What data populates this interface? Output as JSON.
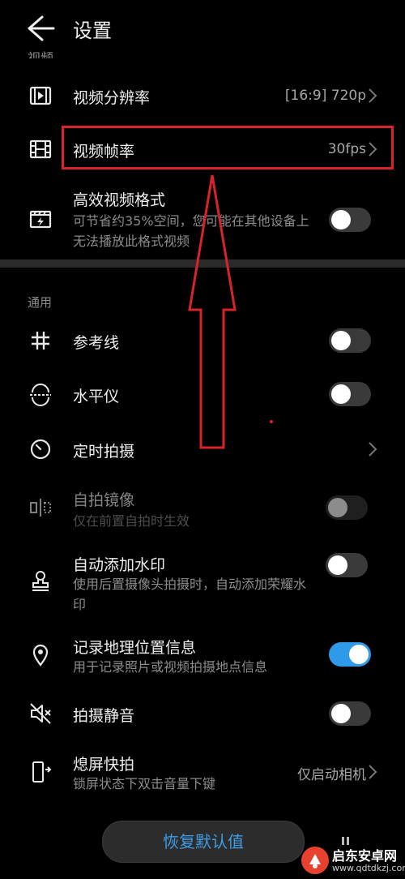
{
  "header": {
    "title": "设置",
    "cut_label": "视频"
  },
  "video": {
    "resolution": {
      "label": "视频分辨率",
      "value": "[16:9] 720p"
    },
    "framerate": {
      "label": "视频帧率",
      "value": "30fps"
    },
    "efficient": {
      "label": "高效视频格式",
      "sub": "可节省约35%空间，您可能在其他设备上无法播放此格式视频",
      "on": false
    }
  },
  "section_general": "通用",
  "general": {
    "gridlines": {
      "label": "参考线",
      "on": false
    },
    "level": {
      "label": "水平仪",
      "on": false
    },
    "timer": {
      "label": "定时拍摄"
    },
    "mirror": {
      "label": "自拍镜像",
      "sub": "仅在前置自拍时生效",
      "on": false
    },
    "watermark": {
      "label": "自动添加水印",
      "sub": "使用后置摄像头拍摄时，自动添加荣耀水印",
      "on": false
    },
    "location": {
      "label": "记录地理位置信息",
      "sub": "用于记录照片或视频拍摄地点信息",
      "on": true
    },
    "mute": {
      "label": "拍摄静音",
      "on": false
    },
    "ultrasnap": {
      "label": "熄屏快拍",
      "sub": "锁屏状态下双击音量下键",
      "value": "仅启动相机"
    }
  },
  "restore_label": "恢复默认值",
  "watermark_site": {
    "name": "启东安卓网",
    "url": "www.qdtdkzj.com"
  },
  "colors": {
    "accent": "#2f9ae8",
    "annotation": "#d8232a",
    "background": "#000000"
  }
}
